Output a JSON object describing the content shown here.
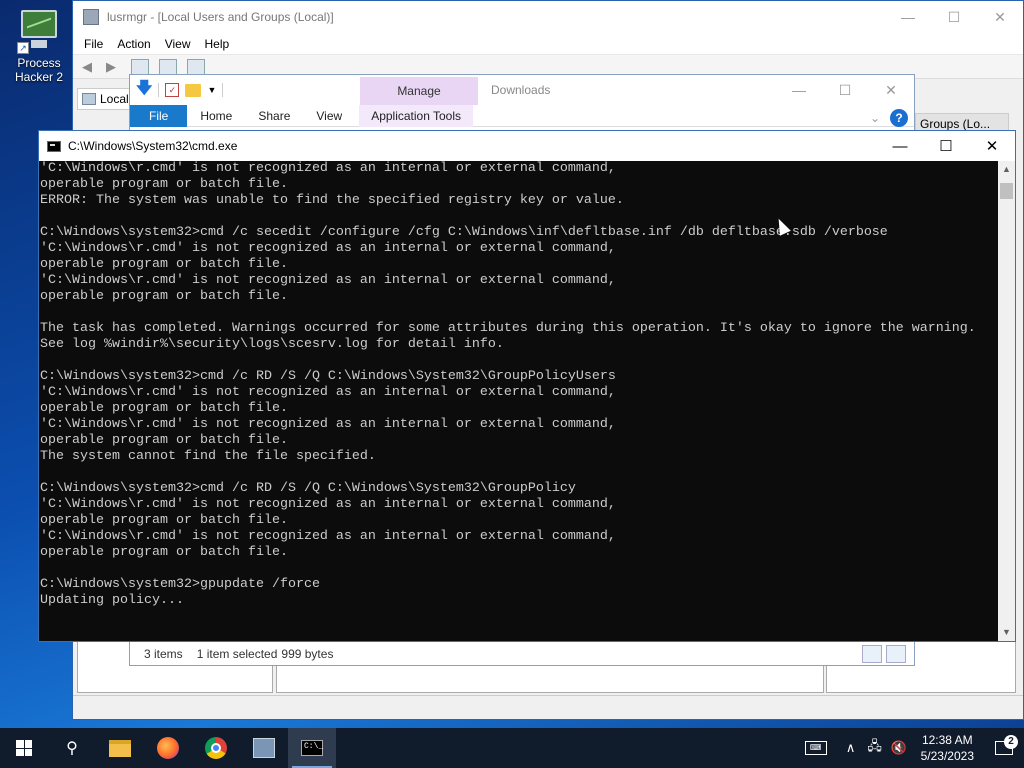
{
  "desktop": {
    "icons": [
      {
        "label": "Process Hacker 2",
        "icon": "process-hacker-icon"
      }
    ]
  },
  "lusrmgr": {
    "title": "lusrmgr - [Local Users and Groups (Local)]",
    "menu": [
      "File",
      "Action",
      "View",
      "Help"
    ],
    "tree_item": "Local",
    "right_header": "Groups (Lo..."
  },
  "explorer": {
    "manage_label": "Manage",
    "window_title": "Downloads",
    "tabs": [
      "File",
      "Home",
      "Share",
      "View",
      "Application Tools"
    ],
    "status": {
      "items": "3 items",
      "selected": "1 item selected",
      "size": "999 bytes"
    }
  },
  "cmd": {
    "title": "C:\\Windows\\System32\\cmd.exe",
    "lines": [
      "'C:\\Windows\\r.cmd' is not recognized as an internal or external command,",
      "operable program or batch file.",
      "ERROR: The system was unable to find the specified registry key or value.",
      "",
      "C:\\Windows\\system32>cmd /c secedit /configure /cfg C:\\Windows\\inf\\defltbase.inf /db defltbase.sdb /verbose",
      "'C:\\Windows\\r.cmd' is not recognized as an internal or external command,",
      "operable program or batch file.",
      "'C:\\Windows\\r.cmd' is not recognized as an internal or external command,",
      "operable program or batch file.",
      "",
      "The task has completed. Warnings occurred for some attributes during this operation. It's okay to ignore the warning.",
      "See log %windir%\\security\\logs\\scesrv.log for detail info.",
      "",
      "C:\\Windows\\system32>cmd /c RD /S /Q C:\\Windows\\System32\\GroupPolicyUsers",
      "'C:\\Windows\\r.cmd' is not recognized as an internal or external command,",
      "operable program or batch file.",
      "'C:\\Windows\\r.cmd' is not recognized as an internal or external command,",
      "operable program or batch file.",
      "The system cannot find the file specified.",
      "",
      "C:\\Windows\\system32>cmd /c RD /S /Q C:\\Windows\\System32\\GroupPolicy",
      "'C:\\Windows\\r.cmd' is not recognized as an internal or external command,",
      "operable program or batch file.",
      "'C:\\Windows\\r.cmd' is not recognized as an internal or external command,",
      "operable program or batch file.",
      "",
      "C:\\Windows\\system32>gpupdate /force",
      "Updating policy..."
    ]
  },
  "taskbar": {
    "apps": [
      {
        "name": "start",
        "icon": "windows-logo-icon"
      },
      {
        "name": "search",
        "icon": "search-icon"
      },
      {
        "name": "file-explorer",
        "icon": "folder-icon"
      },
      {
        "name": "firefox",
        "icon": "firefox-icon"
      },
      {
        "name": "chrome",
        "icon": "chrome-icon"
      },
      {
        "name": "lusrmgr",
        "icon": "users-icon"
      },
      {
        "name": "cmd",
        "icon": "cmd-icon"
      }
    ],
    "clock": {
      "time": "12:38 AM",
      "date": "5/23/2023"
    },
    "notification_count": "2"
  }
}
